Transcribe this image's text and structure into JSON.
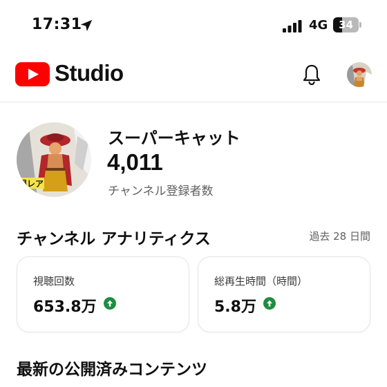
{
  "status_bar": {
    "time": "17:31",
    "network": "4G",
    "battery": "34",
    "battery_level": 0.34
  },
  "header": {
    "app_name": "Studio",
    "brand_color": "#ff0000"
  },
  "channel": {
    "name": "スーパーキャット",
    "subscriber_count": "4,011",
    "subscriber_label": "チャンネル登録者数"
  },
  "analytics": {
    "title": "チャンネル アナリティクス",
    "period": "過去 28 日間",
    "cards": [
      {
        "label": "視聴回数",
        "value": "653.8万",
        "trend": "up",
        "trend_color": "#1e8e3e"
      },
      {
        "label": "総再生時間（時間）",
        "value": "5.8万",
        "trend": "up",
        "trend_color": "#1e8e3e"
      }
    ]
  },
  "latest": {
    "title": "最新の公開済みコンテンツ"
  }
}
